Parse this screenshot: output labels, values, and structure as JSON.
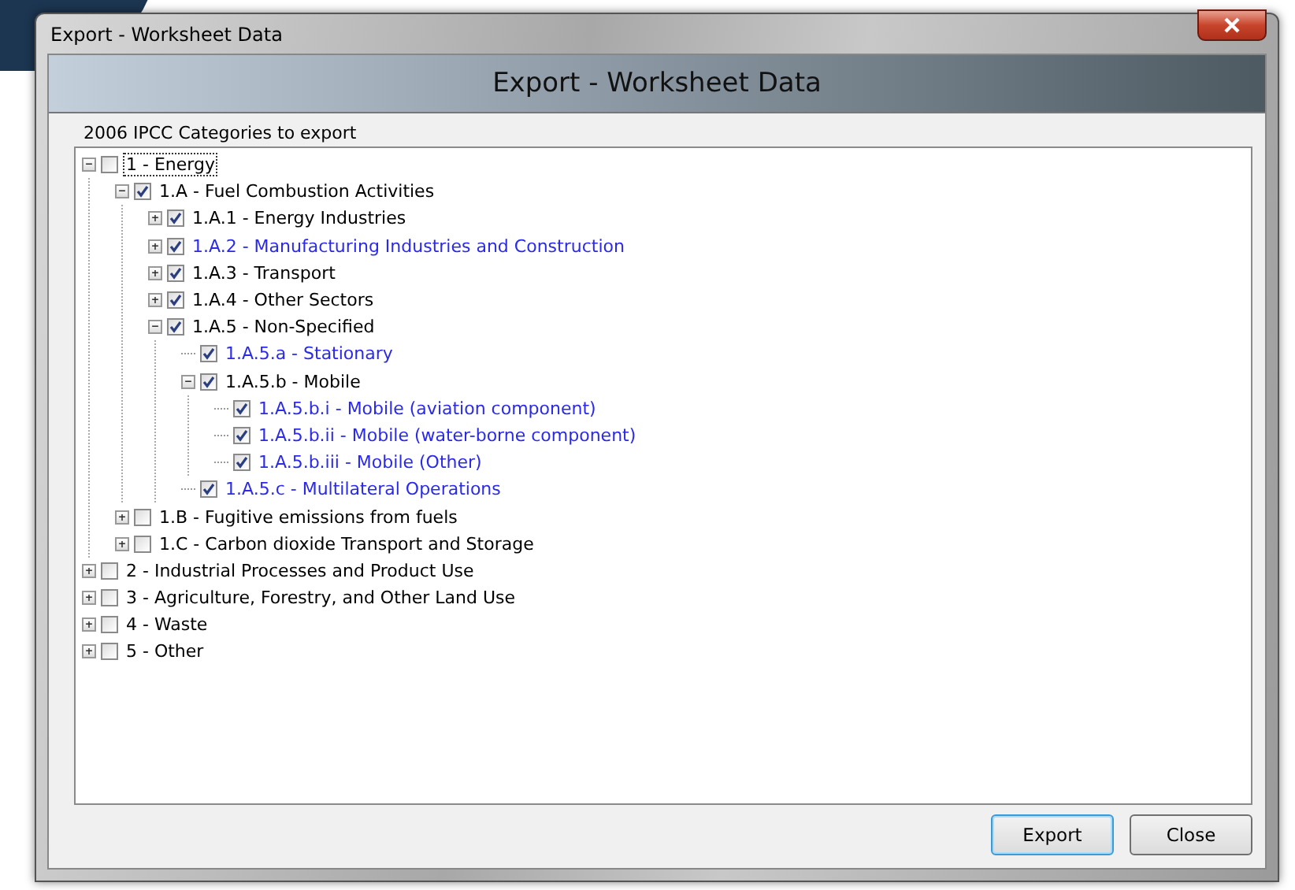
{
  "window": {
    "title": "Export - Worksheet Data"
  },
  "header": {
    "title": "Export - Worksheet Data"
  },
  "group": {
    "label": "2006 IPCC Categories to export"
  },
  "tree": [
    {
      "label": "1 - Energy",
      "checked": false,
      "highlighted": false,
      "focused": true,
      "expanded": true,
      "children": [
        {
          "label": "1.A - Fuel Combustion Activities",
          "checked": true,
          "highlighted": false,
          "focused": false,
          "expanded": true,
          "children": [
            {
              "label": "1.A.1 - Energy Industries",
              "checked": true,
              "highlighted": false,
              "focused": false,
              "expanded": false
            },
            {
              "label": "1.A.2 - Manufacturing Industries and Construction",
              "checked": true,
              "highlighted": true,
              "focused": false,
              "expanded": false
            },
            {
              "label": "1.A.3 - Transport",
              "checked": true,
              "highlighted": false,
              "focused": false,
              "expanded": false
            },
            {
              "label": "1.A.4 - Other Sectors",
              "checked": true,
              "highlighted": false,
              "focused": false,
              "expanded": false
            },
            {
              "label": "1.A.5 - Non-Specified",
              "checked": true,
              "highlighted": false,
              "focused": false,
              "expanded": true,
              "children": [
                {
                  "label": "1.A.5.a - Stationary",
                  "checked": true,
                  "highlighted": true,
                  "focused": false
                },
                {
                  "label": "1.A.5.b - Mobile",
                  "checked": true,
                  "highlighted": false,
                  "focused": false,
                  "expanded": true,
                  "children": [
                    {
                      "label": "1.A.5.b.i - Mobile (aviation component)",
                      "checked": true,
                      "highlighted": true,
                      "focused": false
                    },
                    {
                      "label": "1.A.5.b.ii - Mobile (water-borne component)",
                      "checked": true,
                      "highlighted": true,
                      "focused": false
                    },
                    {
                      "label": "1.A.5.b.iii - Mobile (Other)",
                      "checked": true,
                      "highlighted": true,
                      "focused": false
                    }
                  ]
                },
                {
                  "label": "1.A.5.c - Multilateral Operations",
                  "checked": true,
                  "highlighted": true,
                  "focused": false
                }
              ]
            }
          ]
        },
        {
          "label": "1.B - Fugitive emissions from fuels",
          "checked": false,
          "highlighted": false,
          "focused": false,
          "expanded": false
        },
        {
          "label": "1.C - Carbon dioxide Transport and Storage",
          "checked": false,
          "highlighted": false,
          "focused": false,
          "expanded": false
        }
      ]
    },
    {
      "label": "2 - Industrial Processes and Product Use",
      "checked": false,
      "highlighted": false,
      "focused": false,
      "expanded": false
    },
    {
      "label": "3 - Agriculture, Forestry, and Other Land Use",
      "checked": false,
      "highlighted": false,
      "focused": false,
      "expanded": false
    },
    {
      "label": "4 - Waste",
      "checked": false,
      "highlighted": false,
      "focused": false,
      "expanded": false
    },
    {
      "label": "5 - Other",
      "checked": false,
      "highlighted": false,
      "focused": false,
      "expanded": false
    }
  ],
  "buttons": [
    {
      "label": "Export",
      "default": true
    },
    {
      "label": "Close",
      "default": false
    }
  ]
}
